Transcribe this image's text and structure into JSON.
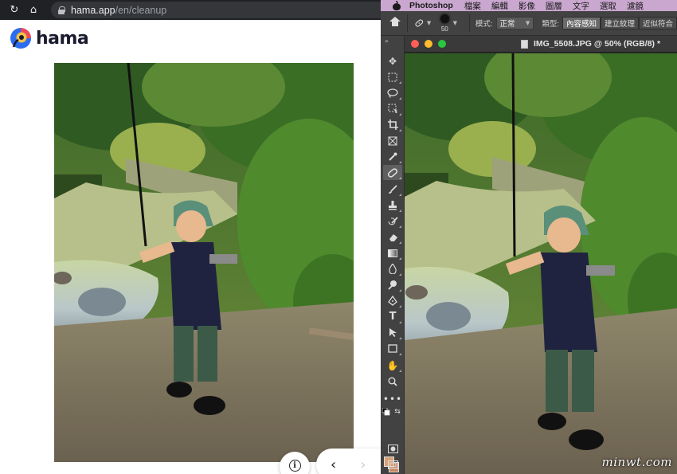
{
  "browser": {
    "url_host": "hama.app",
    "url_path": "/en/cleanup",
    "logo_text": "hama",
    "colors": {
      "logo_blue": "#2b6cf0",
      "logo_red": "#ef4a5a",
      "logo_yellow": "#f6c244",
      "chrome_bg": "#202124"
    }
  },
  "photoshop": {
    "menu": {
      "app_name": "Photoshop",
      "items": [
        "檔案",
        "編輯",
        "影像",
        "圖層",
        "文字",
        "選取",
        "濾鏡"
      ]
    },
    "options": {
      "brush_size": "50",
      "mode_label": "模式:",
      "mode_value": "正常",
      "type_label": "類型:",
      "type_buttons": [
        "內容感知",
        "建立紋理",
        "近似符合"
      ],
      "active_type": 0
    },
    "document": {
      "title": "IMG_5508.JPG @ 50% (RGB/8) *"
    },
    "tools": [
      "move-tool-icon",
      "marquee-tool-icon",
      "lasso-tool-icon",
      "object-select-tool-icon",
      "crop-tool-icon",
      "frame-tool-icon",
      "eyedropper-tool-icon",
      "spot-healing-tool-icon",
      "brush-tool-icon",
      "stamp-tool-icon",
      "history-brush-tool-icon",
      "eraser-tool-icon",
      "gradient-tool-icon",
      "blur-tool-icon",
      "dodge-tool-icon",
      "pen-tool-icon",
      "type-tool-icon",
      "path-select-tool-icon",
      "rectangle-tool-icon",
      "hand-tool-icon",
      "zoom-tool-icon",
      "more-tools-icon"
    ],
    "selected_tool": 7,
    "colors": {
      "foreground": "#d9a178",
      "background": "#c9835a",
      "menubar": "#c9a7cf"
    }
  },
  "watermark": "minwt.com"
}
